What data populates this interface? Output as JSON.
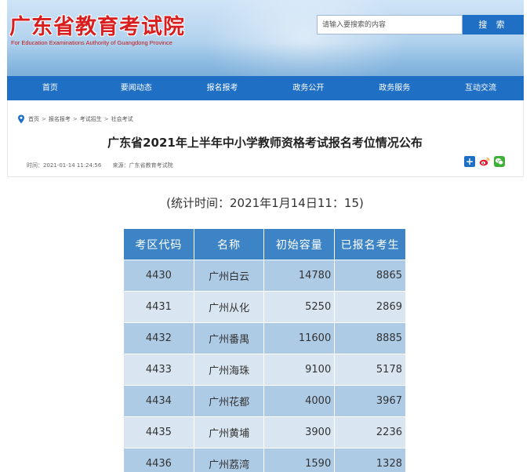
{
  "header": {
    "site_title": "广东省教育考试院",
    "site_subtitle": "For Education Examinations Authority of Guangdong Province",
    "search_placeholder": "请输入要搜索的内容",
    "search_button": "搜 索"
  },
  "nav": {
    "items": [
      "首页",
      "要闻动态",
      "报名报考",
      "政务公开",
      "政务服务",
      "互动交流"
    ]
  },
  "breadcrumb": {
    "items": [
      "首页",
      "报名报考",
      "考试招生",
      "社会考试"
    ],
    "separator": ">"
  },
  "article": {
    "title": "广东省2021年上半年中小学教师资格考试报名考位情况公布",
    "time": "时间：2021-01-14 11:24:56",
    "source": "来源：广东省教育考试院",
    "stat_time": "(统计时间：2021年1月14日11：15)"
  },
  "share": {
    "icons": [
      "share-plus-icon",
      "weibo-icon",
      "wechat-icon"
    ],
    "plus_glyph": "+"
  },
  "table": {
    "headers": [
      "考区代码",
      "名称",
      "初始容量",
      "已报名考生"
    ],
    "rows": [
      [
        "4430",
        "广州白云",
        "14780",
        "8865"
      ],
      [
        "4431",
        "广州从化",
        "5250",
        "2869"
      ],
      [
        "4432",
        "广州番禺",
        "11600",
        "8885"
      ],
      [
        "4433",
        "广州海珠",
        "9100",
        "5178"
      ],
      [
        "4434",
        "广州花都",
        "4000",
        "3967"
      ],
      [
        "4435",
        "广州黄埔",
        "3900",
        "2236"
      ],
      [
        "4436",
        "广州荔湾",
        "1590",
        "1328"
      ]
    ]
  },
  "colors": {
    "nav_blue": "#1f6fc5",
    "header_cell": "#3d84c6",
    "row_dark": "#aecbe6",
    "row_light": "#d9e6f2",
    "title_red": "#d81e1e"
  }
}
